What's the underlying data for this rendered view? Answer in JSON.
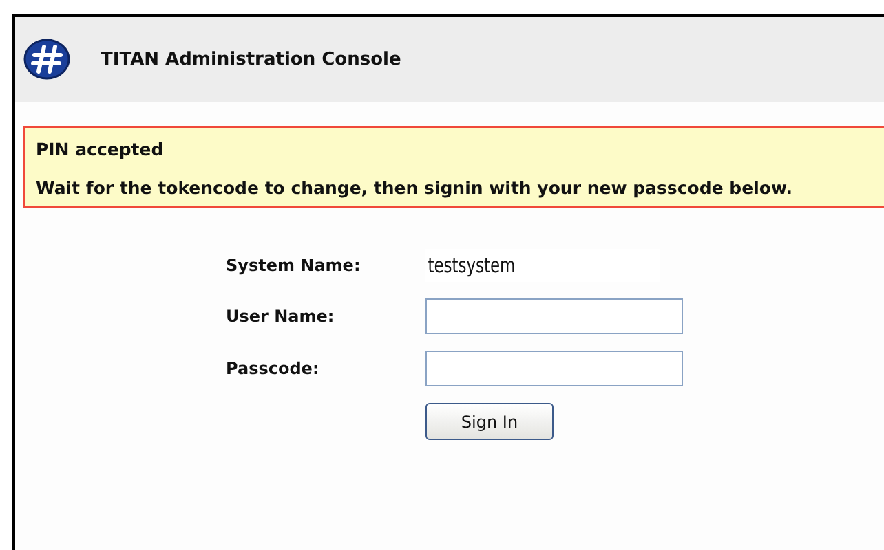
{
  "header": {
    "title": "TITAN Administration Console"
  },
  "alert": {
    "heading": "PIN accepted",
    "message": "Wait for the tokencode to change, then signin with your new passcode below."
  },
  "form": {
    "fields": [
      {
        "kind": "static",
        "label": "System Name:",
        "value": "testsystem"
      },
      {
        "kind": "input",
        "label": "User Name:"
      },
      {
        "kind": "input",
        "label": "Passcode:"
      }
    ],
    "submit": "Sign In"
  }
}
